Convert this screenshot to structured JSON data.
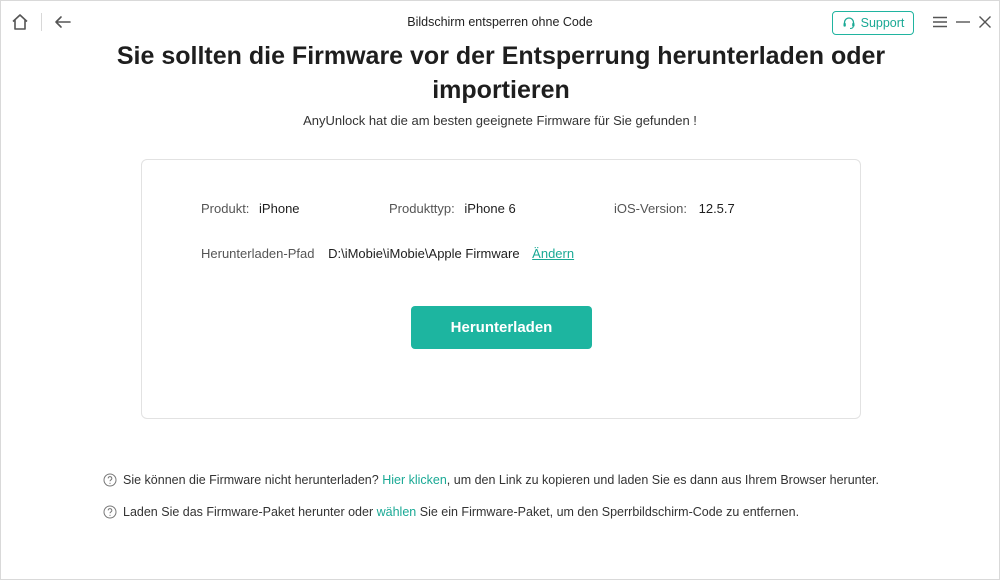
{
  "window": {
    "title": "Bildschirm entsperren ohne Code",
    "support_label": "Support"
  },
  "heading": {
    "title": "Sie sollten die Firmware vor der Entsperrung herunterladen oder importieren",
    "subtitle": "AnyUnlock hat die am besten geeignete Firmware für Sie gefunden !"
  },
  "device": {
    "product_label": "Produkt:",
    "product_value": "iPhone",
    "type_label": "Produkttyp:",
    "type_value": "iPhone 6",
    "ios_label": "iOS-Version:",
    "ios_value": "12.5.7",
    "path_label": "Herunterladen-Pfad",
    "path_value": "D:\\iMobie\\iMobie\\Apple Firmware",
    "change_label": "Ändern"
  },
  "actions": {
    "download_label": "Herunterladen"
  },
  "hints": [
    {
      "before": "Sie können die Firmware nicht herunterladen?",
      "link": "Hier klicken",
      "after": ", um den Link zu kopieren und laden Sie es dann aus Ihrem Browser herunter."
    },
    {
      "before": "Laden Sie das Firmware-Paket herunter oder",
      "link": "wählen",
      "after": "Sie ein Firmware-Paket, um den Sperrbildschirm-Code zu entfernen."
    }
  ],
  "colors": {
    "accent": "#1db5a0",
    "link": "#1aa995"
  }
}
